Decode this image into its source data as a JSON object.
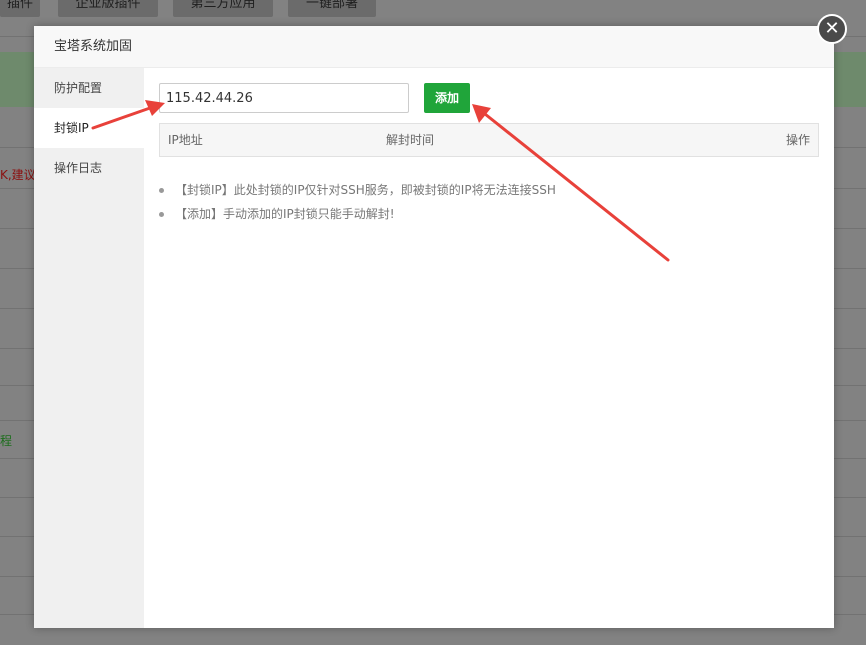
{
  "background": {
    "tabs": [
      "插件",
      "企业版插件",
      "第三方应用",
      "一键部署"
    ],
    "red_fragment": "K,建议修",
    "green_fragment": "程"
  },
  "dialog": {
    "title": "宝塔系统加固",
    "close_symbol": "✕",
    "sidebar": {
      "items": [
        {
          "label": "防护配置",
          "active": false
        },
        {
          "label": "封锁IP",
          "active": true
        },
        {
          "label": "操作日志",
          "active": false
        }
      ]
    },
    "ip_input": {
      "value": "115.42.44.26"
    },
    "add_button": "添加",
    "table": {
      "headers": [
        "IP地址",
        "解封时间",
        "操作"
      ]
    },
    "notes": [
      "【封锁IP】此处封锁的IP仅针对SSH服务，即被封锁的IP将无法连接SSH",
      "【添加】手动添加的IP封锁只能手动解封!"
    ]
  },
  "colors": {
    "accent_green": "#20a53a",
    "arrow_red": "#e8413a"
  }
}
